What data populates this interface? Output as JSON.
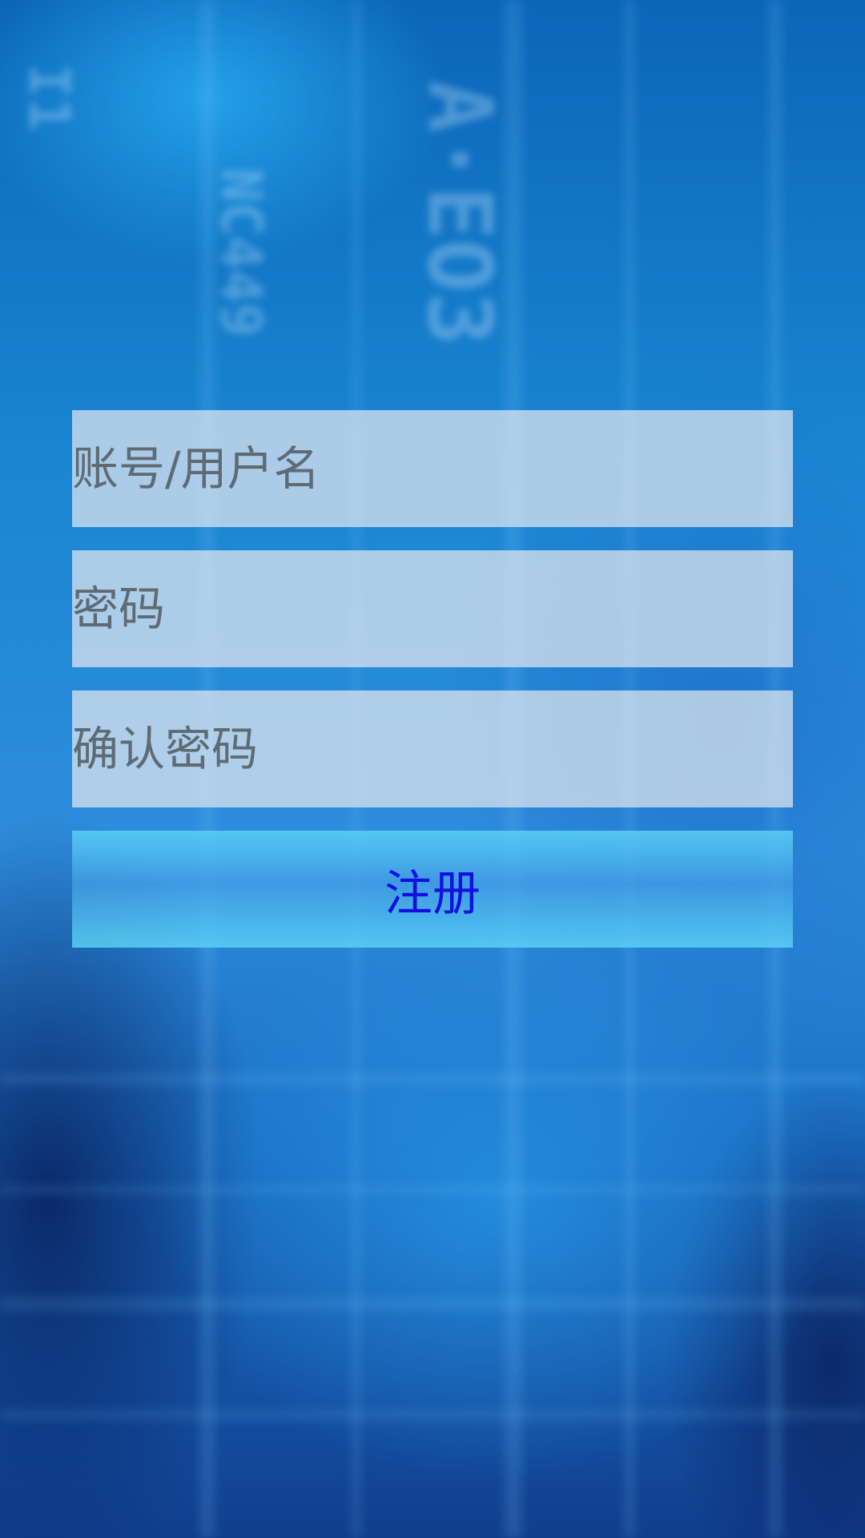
{
  "background": {
    "description_icon": "blurred-tech-background",
    "glyphs": [
      "A·EO3",
      "NC449",
      "I1"
    ]
  },
  "form": {
    "account_placeholder": "账号/用户名",
    "password_placeholder": "密码",
    "confirm_password_placeholder": "确认密码",
    "register_label": "注册"
  },
  "colors": {
    "register_text": "#1010e0",
    "field_background": "#e2e8f0",
    "placeholder_text": "#5f6b74"
  }
}
